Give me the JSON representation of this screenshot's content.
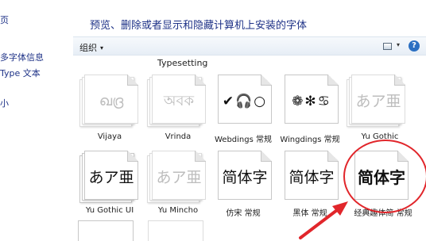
{
  "left_nav": {
    "items": [
      "页",
      "多字体信息",
      "Type 文本",
      "小"
    ]
  },
  "header": {
    "title": "预览、删除或者显示和隐藏计算机上安装的字体"
  },
  "toolbar": {
    "organize_label": "组织",
    "organize_caret": "▾",
    "view_caret": "▾",
    "help_label": "?"
  },
  "partial_row_label": "Typesetting",
  "fonts": [
    {
      "name": "Vijaya",
      "sample": "ഖദ്ര",
      "faded": true,
      "stacked": true
    },
    {
      "name": "Vrinda",
      "sample": "অবক",
      "faded": true,
      "stacked": true
    },
    {
      "name": "Webdings 常规",
      "sample": "✔🎧○",
      "faded": false,
      "stacked": false
    },
    {
      "name": "Wingdings 常规",
      "sample": "❁✻♋",
      "faded": false,
      "stacked": false
    },
    {
      "name": "Yu Gothic",
      "sample": "あア亜",
      "faded": true,
      "stacked": true
    },
    {
      "name": "Yu Gothic UI",
      "sample": "あア亜",
      "faded": false,
      "stacked": true
    },
    {
      "name": "Yu Mincho",
      "sample": "あア亜",
      "faded": true,
      "stacked": true
    },
    {
      "name": "仿宋 常规",
      "sample": "简体字",
      "faded": false,
      "stacked": false
    },
    {
      "name": "黑体 常规",
      "sample": "简体字",
      "faded": false,
      "stacked": false
    },
    {
      "name": "经典趣体简 常规",
      "sample": "简体字",
      "faded": false,
      "stacked": false
    }
  ],
  "colors": {
    "link": "#1e3287",
    "annotation": "#e1262b"
  }
}
